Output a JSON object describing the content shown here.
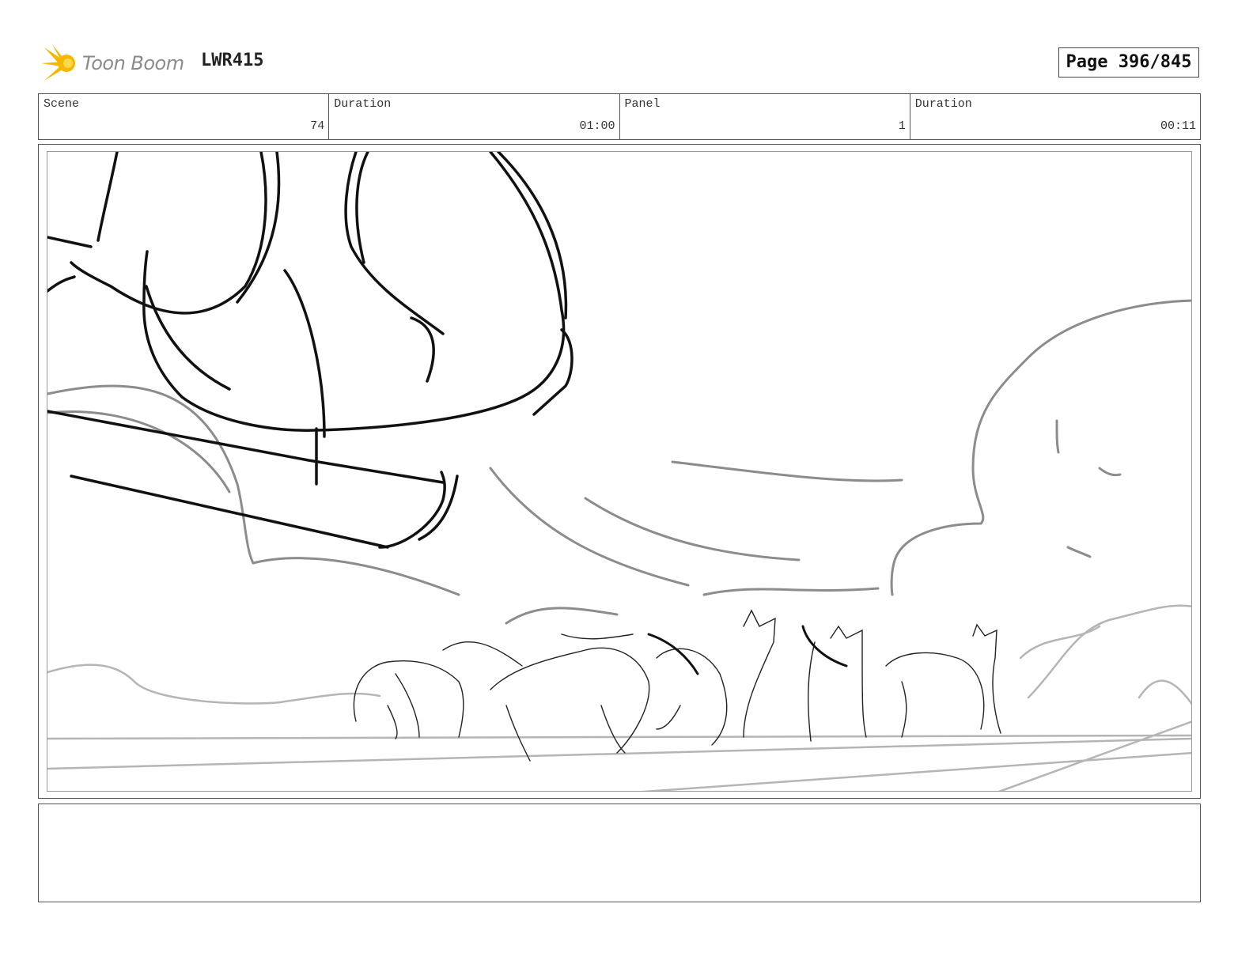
{
  "header": {
    "logo_text": "Toon Boom",
    "project_code": "LWR415",
    "page_label": "Page 396/845"
  },
  "info_bar": {
    "scene_label": "Scene",
    "scene_value": "74",
    "scene_duration_label": "Duration",
    "scene_duration_value": "01:00",
    "panel_label": "Panel",
    "panel_value": "1",
    "panel_duration_label": "Duration",
    "panel_duration_value": "00:11"
  },
  "colors": {
    "logo_star": "#f5b800",
    "sketch_dark": "#111111",
    "sketch_light": "#b5b5b5"
  },
  "notes": {
    "text": ""
  }
}
